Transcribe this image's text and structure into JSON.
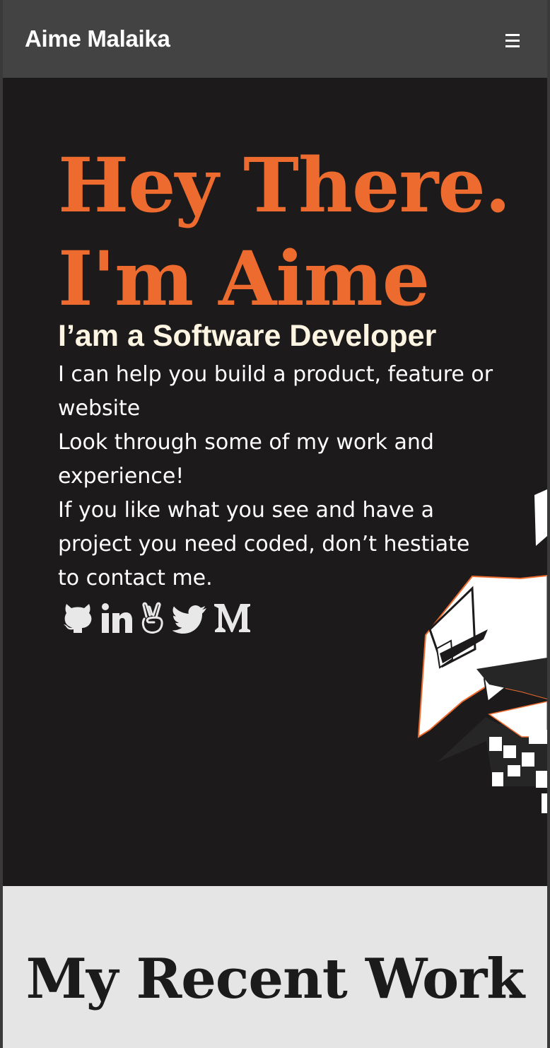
{
  "navbar": {
    "brand": "Aime Malaika",
    "menu_icon": "hamburger-menu-icon"
  },
  "hero": {
    "title_lines": [
      "Hey There.",
      "I'm Aime"
    ],
    "subtitle": "I’am a Software Developer",
    "paragraphs": [
      "I can help you build a product, feature or website",
      "Look through some of my work and experience!",
      "If you like what you see and have a project you need coded, don’t hestiate to contact me."
    ],
    "socials": [
      {
        "icon": "github-icon"
      },
      {
        "icon": "linkedin-icon"
      },
      {
        "icon": "angellist-icon"
      },
      {
        "icon": "twitter-icon"
      },
      {
        "icon": "medium-icon"
      }
    ],
    "decoration": "abstract-geometric-illustration"
  },
  "recent_work": {
    "title": "My Recent Work"
  },
  "colors": {
    "accent": "#ee6b2f",
    "navbar_bg": "#434343",
    "hero_bg": "#1c1a1a",
    "subtitle": "#fdf5e2",
    "section_bg": "#e5e5e5",
    "icon": "#e8e8e8"
  }
}
